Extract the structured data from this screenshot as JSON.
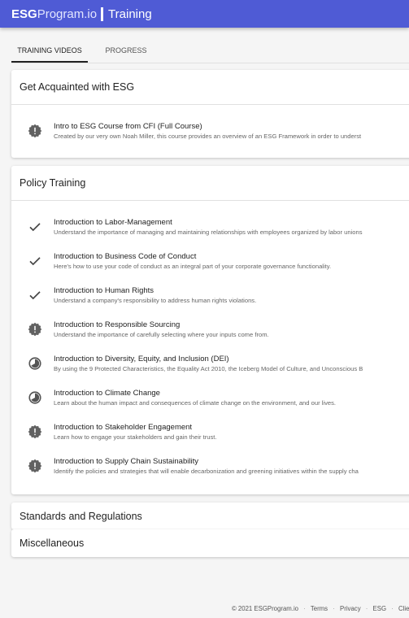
{
  "brand": {
    "bold": "ESG",
    "light": "Program.io",
    "page": "Training"
  },
  "tabs": [
    {
      "label": "TRAINING VIDEOS",
      "active": true
    },
    {
      "label": "PROGRESS",
      "active": false
    }
  ],
  "sections": {
    "acquainted": {
      "title": "Get Acquainted with ESG",
      "items": [
        {
          "title": "Intro to ESG Course from CFI (Full Course)",
          "description": "Created by our very own Noah Miller, this course provides an overview of an ESG Framework in order to underst",
          "status": "alert-badge-icon"
        }
      ]
    },
    "policy": {
      "title": "Policy Training",
      "items": [
        {
          "title": "Introduction to Labor-Management",
          "description": "Understand the importance of managing and maintaining relationships with employees organized by labor unions",
          "status": "check-icon"
        },
        {
          "title": "Introduction to Business Code of Conduct",
          "description": "Here's how to use your code of conduct as an integral part of your corporate governance functionality.",
          "status": "check-icon"
        },
        {
          "title": "Introduction to Human Rights",
          "description": "Understand a company's responsibility to address human rights violations.",
          "status": "check-icon"
        },
        {
          "title": "Introduction to Responsible Sourcing",
          "description": "Understand the importance of carefully selecting where your inputs come from.",
          "status": "alert-badge-icon"
        },
        {
          "title": "Introduction to Diversity, Equity, and Inclusion (DEI)",
          "description": "By using the 9 Protected Characteristics, the Equality Act 2010, the Iceberg Model of Culture, and Unconscious B",
          "status": "in-progress-icon"
        },
        {
          "title": "Introduction to Climate Change",
          "description": "Learn about the human impact and consequences of climate change on the environment, and our lives.",
          "status": "in-progress-icon"
        },
        {
          "title": "Introduction to Stakeholder Engagement",
          "description": "Learn how to engage your stakeholders and gain their trust.",
          "status": "alert-badge-icon"
        },
        {
          "title": "Introduction to Supply Chain Sustainability",
          "description": "Identify the policies and strategies that will enable decarbonization and greening initiatives within the supply cha",
          "status": "alert-badge-icon"
        }
      ]
    },
    "standards": {
      "title": "Standards and Regulations"
    },
    "misc": {
      "title": "Miscellaneous"
    }
  },
  "footer": {
    "copyright": "© 2021 ESGProgram.io",
    "links": [
      "Terms",
      "Privacy",
      "ESG",
      "Clie"
    ],
    "separator": "·"
  },
  "colors": {
    "appbar": "#4f5bd5",
    "icon": "#616161"
  }
}
